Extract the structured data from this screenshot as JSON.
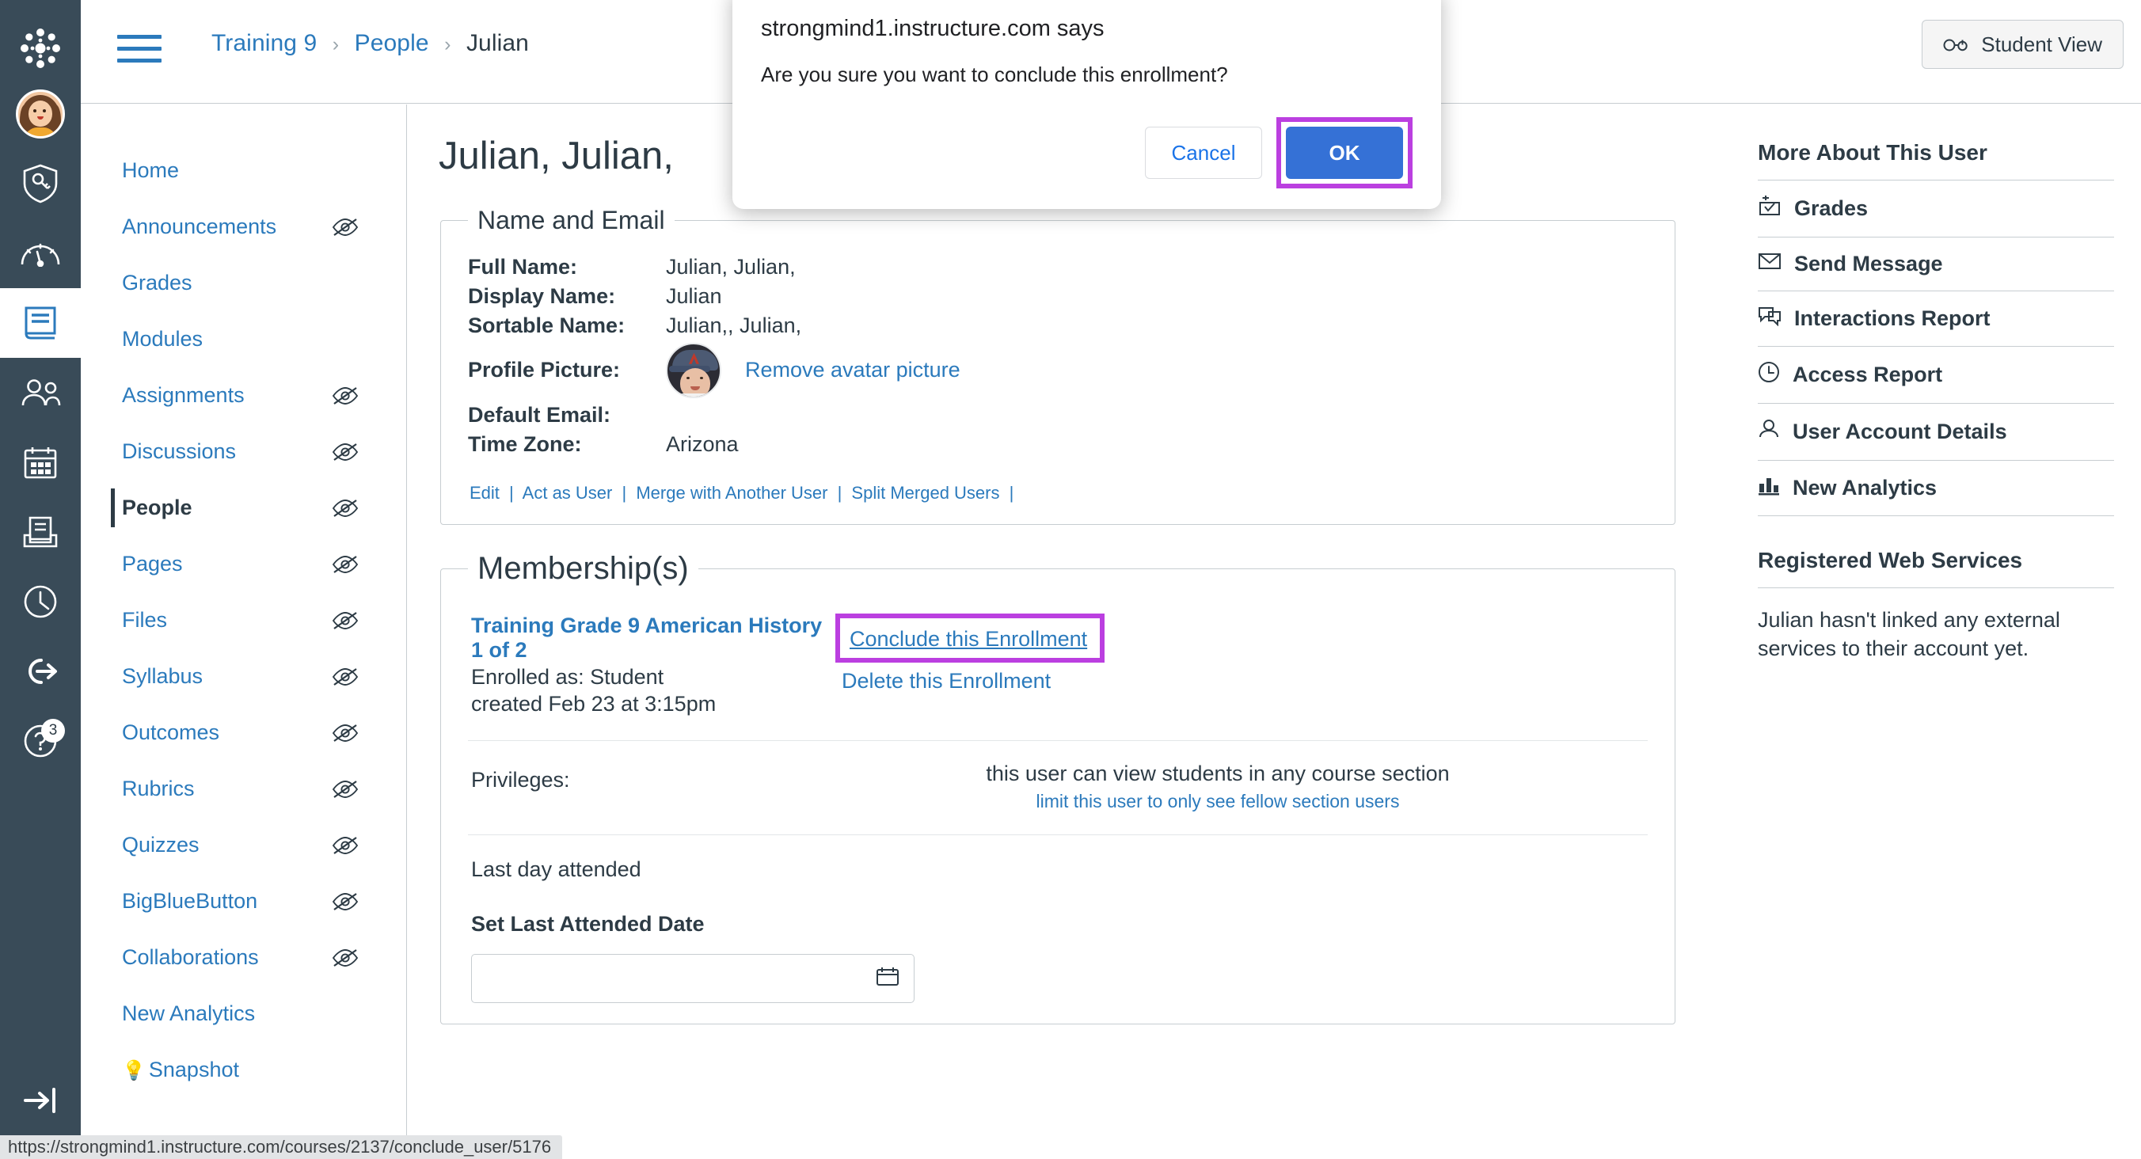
{
  "global_nav": {
    "items": [
      {
        "name": "canvas-logo",
        "label": "Canvas"
      },
      {
        "name": "account",
        "label": "Account"
      },
      {
        "name": "admin",
        "label": "Admin"
      },
      {
        "name": "dashboard",
        "label": "Dashboard"
      },
      {
        "name": "courses",
        "label": "Courses"
      },
      {
        "name": "groups",
        "label": "Groups"
      },
      {
        "name": "calendar",
        "label": "Calendar"
      },
      {
        "name": "inbox",
        "label": "Inbox"
      },
      {
        "name": "history",
        "label": "History"
      },
      {
        "name": "commons",
        "label": "Commons"
      },
      {
        "name": "help",
        "label": "Help"
      }
    ],
    "help_badge_count": "3"
  },
  "topbar": {
    "breadcrumb": {
      "course": "Training 9",
      "section": "People",
      "current": "Julian",
      "separator": "›"
    },
    "student_view_label": "Student View"
  },
  "course_nav": {
    "items": [
      {
        "label": "Home",
        "hidden_icon": false,
        "active": false
      },
      {
        "label": "Announcements",
        "hidden_icon": true,
        "active": false
      },
      {
        "label": "Grades",
        "hidden_icon": false,
        "active": false
      },
      {
        "label": "Modules",
        "hidden_icon": false,
        "active": false
      },
      {
        "label": "Assignments",
        "hidden_icon": true,
        "active": false
      },
      {
        "label": "Discussions",
        "hidden_icon": true,
        "active": false
      },
      {
        "label": "People",
        "hidden_icon": true,
        "active": true
      },
      {
        "label": "Pages",
        "hidden_icon": true,
        "active": false
      },
      {
        "label": "Files",
        "hidden_icon": true,
        "active": false
      },
      {
        "label": "Syllabus",
        "hidden_icon": true,
        "active": false
      },
      {
        "label": "Outcomes",
        "hidden_icon": true,
        "active": false
      },
      {
        "label": "Rubrics",
        "hidden_icon": true,
        "active": false
      },
      {
        "label": "Quizzes",
        "hidden_icon": true,
        "active": false
      },
      {
        "label": "BigBlueButton",
        "hidden_icon": true,
        "active": false
      },
      {
        "label": "Collaborations",
        "hidden_icon": true,
        "active": false
      },
      {
        "label": "New Analytics",
        "hidden_icon": false,
        "active": false
      }
    ],
    "snapshot_label": "Snapshot",
    "snapshot_icon": "lightbulb-icon"
  },
  "main": {
    "page_title": "Julian, Julian,",
    "name_email": {
      "legend": "Name and Email",
      "rows": [
        {
          "label": "Full Name:",
          "value": "Julian, Julian,"
        },
        {
          "label": "Display Name:",
          "value": "Julian"
        },
        {
          "label": "Sortable Name:",
          "value": "Julian,, Julian,"
        }
      ],
      "profile_picture_label": "Profile Picture:",
      "remove_avatar_label": "Remove avatar picture",
      "default_email_label": "Default Email:",
      "default_email_value": "",
      "time_zone_label": "Time Zone:",
      "time_zone_value": "Arizona",
      "action_links": [
        "Edit",
        "Act as User",
        "Merge with Another User",
        "Split Merged Users"
      ],
      "action_sep": "|"
    },
    "membership": {
      "legend": "Membership(s)",
      "course_name": "Training Grade 9 American History 1 of 2",
      "enrolled_as": "Enrolled as: Student",
      "created": "created Feb 23 at 3:15pm",
      "conclude_label": "Conclude this Enrollment",
      "delete_label": "Delete this Enrollment",
      "privileges_label": "Privileges:",
      "privileges_text": "this user can view students in any course section",
      "privileges_link": "limit this user to only see fellow section users",
      "last_day_label": "Last day attended",
      "set_last_attended_label": "Set Last Attended Date",
      "date_value": "",
      "date_icon": "calendar-icon"
    }
  },
  "right_sidebar": {
    "title": "More About This User",
    "items": [
      {
        "label": "Grades",
        "icon": "gradebook-icon"
      },
      {
        "label": "Send Message",
        "icon": "envelope-icon"
      },
      {
        "label": "Interactions Report",
        "icon": "discussion-icon"
      },
      {
        "label": "Access Report",
        "icon": "clock-icon"
      },
      {
        "label": "User Account Details",
        "icon": "user-icon"
      },
      {
        "label": "New Analytics",
        "icon": "bar-chart-icon"
      }
    ],
    "web_services_title": "Registered Web Services",
    "web_services_note": "Julian hasn't linked any external services to their account yet."
  },
  "dialog": {
    "title": "strongmind1.instructure.com says",
    "message": "Are you sure you want to conclude this enrollment?",
    "cancel_label": "Cancel",
    "ok_label": "OK",
    "highlight_color": "#BB3FE0",
    "ok_color": "#3571D6"
  },
  "status_bar": {
    "url": "https://strongmind1.instructure.com/courses/2137/conclude_user/5176"
  },
  "colors": {
    "brand_link": "#2B7ABC",
    "global_nav_bg": "#394B58",
    "text": "#2D3B45",
    "highlight": "#BB3FE0"
  }
}
